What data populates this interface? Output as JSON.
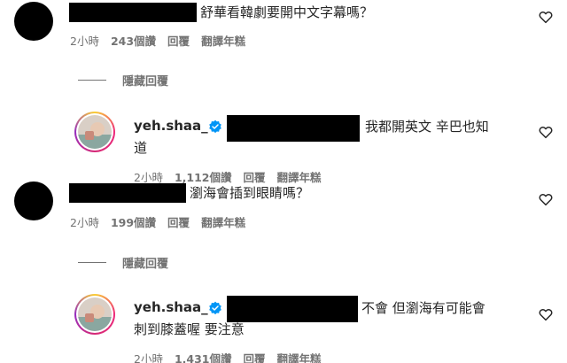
{
  "colors": {
    "text": "#262626",
    "meta": "#737373",
    "verified": "#0095f6"
  },
  "comments": [
    {
      "text": "舒華看韓劇要開中文字幕嗎？",
      "time": "2小時",
      "likes": "243個讚",
      "reply": "回覆",
      "translate": "翻譯年糕"
    },
    {
      "text": "瀏海會插到眼睛嗎？",
      "time": "2小時",
      "likes": "199個讚",
      "reply": "回覆",
      "translate": "翻譯年糕"
    }
  ],
  "hide_replies": "隱藏回覆",
  "replies": [
    {
      "username": "yeh.shaa_",
      "line1": "我都開英文 辛巴也知",
      "line2": "道",
      "time": "2小時",
      "likes": "1,112個讚",
      "reply": "回覆",
      "translate": "翻譯年糕"
    },
    {
      "username": "yeh.shaa_",
      "line1": "不會 但瀏海有可能會",
      "line2": "刺到膝蓋喔 要注意",
      "time": "2小時",
      "likes": "1,431個讚",
      "reply": "回覆",
      "translate": "翻譯年糕"
    }
  ],
  "icons": {
    "like": "heart-icon",
    "verified": "verified-badge-icon"
  }
}
